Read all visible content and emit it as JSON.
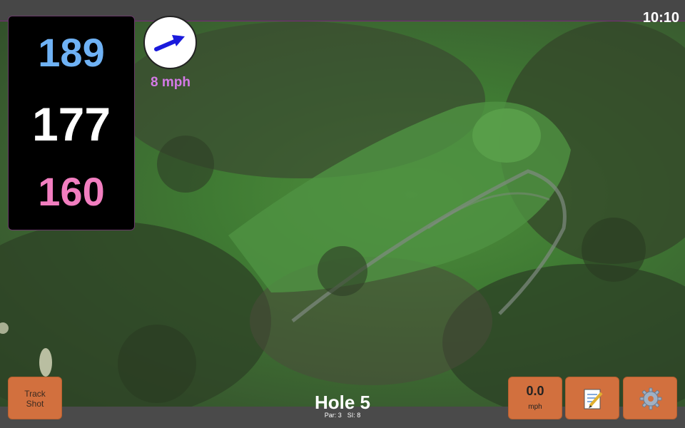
{
  "status": {
    "time": "10:10"
  },
  "distances": {
    "back": "189",
    "center": "177",
    "front": "160"
  },
  "wind": {
    "speed": "8 mph",
    "icon": "wind-direction-arrow-icon",
    "arrow_color": "#1a1adc"
  },
  "hole": {
    "title": "Hole 5",
    "par": "Par: 3",
    "si": "SI: 8"
  },
  "buttons": {
    "track_shot_line1": "Track",
    "track_shot_line2": "Shot",
    "speed_value": "0.0",
    "speed_unit": "mph",
    "notes_icon": "notepad-icon",
    "settings_icon": "gear-icon"
  },
  "colors": {
    "back": "#6fb2f5",
    "center": "#ffffff",
    "front": "#f27ec0",
    "wind_text": "#d47ae6",
    "button": "#d2703e"
  }
}
